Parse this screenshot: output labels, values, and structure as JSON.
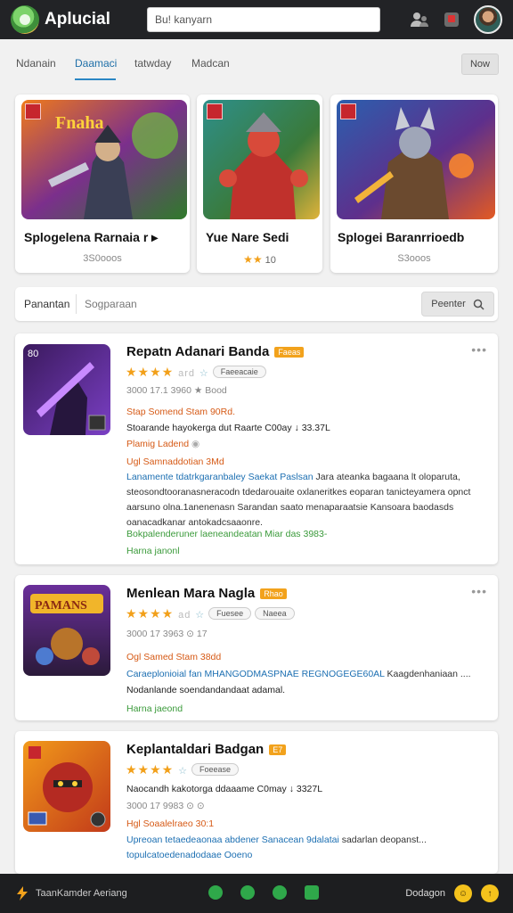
{
  "app": {
    "title": "Aplucial"
  },
  "search": {
    "value": "Bu! kanyarn"
  },
  "tabs": [
    {
      "label": "Ndanain"
    },
    {
      "label": "Daamaci"
    },
    {
      "label": "tatwday"
    },
    {
      "label": "Madcan"
    }
  ],
  "now_button": "Now",
  "featured": [
    {
      "title": "Splogelena Rarnaia r ▸",
      "subtitle": "3S0ooos"
    },
    {
      "title": "Yue Nare Sedi",
      "subtitle": "10"
    },
    {
      "title": "Splogei Baranrrioedb",
      "subtitle": "S3ooos"
    }
  ],
  "filter": {
    "tab1": "Panantan",
    "tab2": "Sogparaan",
    "button": "Peenter"
  },
  "items": [
    {
      "name": "Repatn Adanari Banda",
      "tag": "Faeas",
      "rating_suffix": "ard",
      "pill1": "Faeeacaie",
      "meta": "3000 17.1 3960 ★ Bood",
      "line_orange1": "Stap Somend Stam 90Rd.",
      "line_dark1": "Stoarande hayokerga dut Raarte C00ay ↓ 33.37L",
      "line_orange2": "Plamig Ladend",
      "line_orange3": "Ugl Samnaddotian 3Md",
      "para_blue": "Lanamente tdatrkgaranbaley Saekat Paslsan",
      "para_text": " Jara ateanka bagaana lt oloparuta, steosondtooranasneracodn tdedarouaite oxlaneritkes eoparan tanicteyamera opnct aarsuno olna.1anenenasn Sarandan saato menaparaatsie Kansoara baodasds oanacadkanar antokadcsaaonre.",
      "line_green1": "Bokpalenderuner laeneandeatan Miar das 3983-",
      "line_green2": "Harna janonl"
    },
    {
      "name": "Menlean Mara Nagla",
      "tag": "Rhao",
      "rating_suffix": "ad",
      "pill1": "Fuesee",
      "pill2": "Naeea",
      "meta": "3000 17 3963 ⊙ 17",
      "line_orange1": "Ogl Samed Stam 38dd",
      "para_blue": "Caraeplonioial fan MHANGODMASPNAE REGNOGEGE60AL",
      "para_text": " Kaagdenhaniaan ....",
      "line_dark1": "Nodanlande soendandandaat adamal.",
      "line_green2": "Harna jaeond"
    },
    {
      "name": "Keplantaldari Badgan",
      "tag": "E7",
      "rating_suffix": "",
      "pill1": "Foeease",
      "line_dark1": "Naocandh kakotorga ddaaame C0may ↓ 3327L",
      "meta": "3000 17 9983 ⊙ ⊙",
      "line_orange1": "Hgl Soaalelraeo 30:1",
      "para_blue": "Upreoan tetaedeaonaa abdener Sanacean 9dalatai",
      "para_text": " sadarlan deopanst...",
      "line_blue2": "topulcatoedenadodaae Ooeno"
    }
  ],
  "bottom": {
    "left": "TaanKamder Aeriang",
    "right": "Dodagon"
  }
}
